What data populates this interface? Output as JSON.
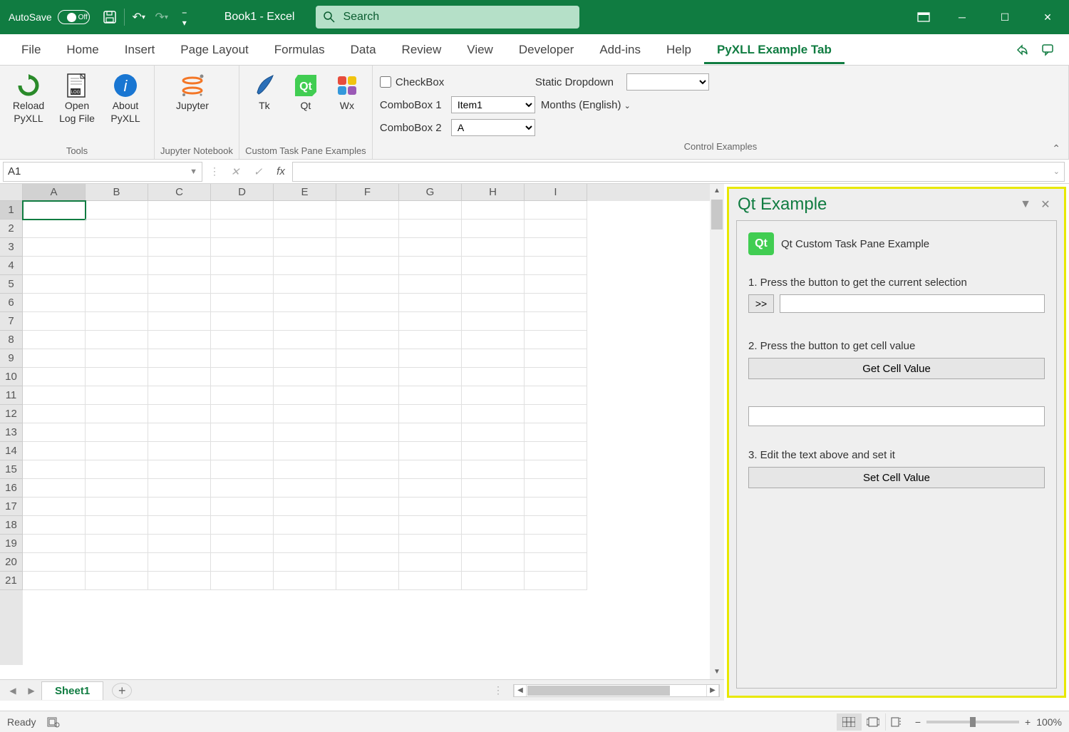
{
  "titlebar": {
    "autosave_label": "AutoSave",
    "autosave_state": "Off",
    "doc_title": "Book1  -  Excel",
    "search_placeholder": "Search"
  },
  "ribbon_tabs": [
    "File",
    "Home",
    "Insert",
    "Page Layout",
    "Formulas",
    "Data",
    "Review",
    "View",
    "Developer",
    "Add-ins",
    "Help",
    "PyXLL Example Tab"
  ],
  "active_tab": "PyXLL Example Tab",
  "ribbon": {
    "tools_group": "Tools",
    "reload_pyxll": "Reload PyXLL",
    "open_logfile": "Open Log File",
    "about_pyxll": "About PyXLL",
    "jupyter_group": "Jupyter Notebook",
    "jupyter": "Jupyter",
    "taskpane_group": "Custom Task Pane Examples",
    "tk": "Tk",
    "qt": "Qt",
    "wx": "Wx",
    "control_group": "Control Examples",
    "checkbox": "CheckBox",
    "static_dropdown": "Static Dropdown",
    "combobox1_label": "ComboBox 1",
    "combobox1_value": "Item1",
    "combobox2_label": "ComboBox 2",
    "combobox2_value": "A",
    "months": "Months (English)"
  },
  "formula": {
    "namebox": "A1",
    "fx": "fx"
  },
  "grid": {
    "columns": [
      "A",
      "B",
      "C",
      "D",
      "E",
      "F",
      "G",
      "H",
      "I"
    ],
    "rows": [
      1,
      2,
      3,
      4,
      5,
      6,
      7,
      8,
      9,
      10,
      11,
      12,
      13,
      14,
      15,
      16,
      17,
      18,
      19,
      20,
      21
    ],
    "active_cell": "A1"
  },
  "sheets": {
    "active": "Sheet1"
  },
  "taskpane": {
    "title": "Qt Example",
    "subtitle": "Qt Custom Task Pane Example",
    "step1": "1. Press the button to get the current selection",
    "selection_btn": ">>",
    "step2": "2. Press the button to get cell value",
    "get_cell_btn": "Get Cell Value",
    "step3": "3. Edit the text above and set it",
    "set_cell_btn": "Set Cell Value"
  },
  "status": {
    "ready": "Ready",
    "zoom": "100%"
  }
}
